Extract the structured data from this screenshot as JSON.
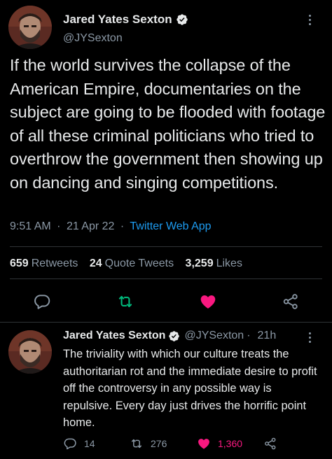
{
  "tweet": {
    "author_name": "Jared Yates Sexton",
    "handle": "@JYSexton",
    "text": "If the world survives the collapse of the American Empire, documentaries on the subject are going to be flooded with footage of all these criminal politicians who tried to overthrow the government then showing up on dancing and singing competitions.",
    "time": "9:51 AM",
    "date": "21 Apr 22",
    "dot": "·",
    "source": "Twitter Web App",
    "stats": {
      "retweets_count": "659",
      "retweets_label": "Retweets",
      "quotes_count": "24",
      "quotes_label": "Quote Tweets",
      "likes_count": "3,259",
      "likes_label": "Likes"
    },
    "icons": [
      "reply-icon",
      "retweet-icon",
      "like-icon",
      "share-icon"
    ]
  },
  "reply": {
    "author_name": "Jared Yates Sexton",
    "handle": "@JYSexton",
    "dot": "·",
    "age": "21h",
    "text": "The triviality with which our culture treats the authoritarian rot and the immediate desire to profit off the controversy in any possible way is repulsive. Every day just drives the horrific point home.",
    "reply_count": "14",
    "retweet_count": "276",
    "like_count": "1,360"
  },
  "colors": {
    "background": "#000000",
    "text": "#e7e9ea",
    "secondary": "#8b98a5",
    "link": "#1d9bf0",
    "retweet": "#00ba7c",
    "like": "#f91880",
    "divider": "#2f3336"
  }
}
